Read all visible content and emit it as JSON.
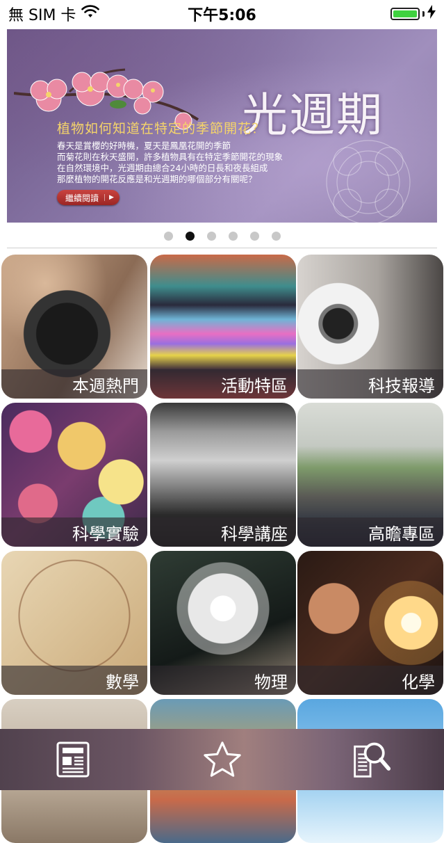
{
  "status_bar": {
    "carrier": "無 SIM 卡",
    "time": "下午5:06",
    "battery_level": 1.0,
    "icons": [
      "wifi-icon",
      "battery-icon",
      "charging-icon"
    ]
  },
  "banner": {
    "title": "光週期",
    "subtitle": "植物如何知道在特定的季節開花？",
    "body_lines": [
      "春天是賞櫻的好時機，夏天是鳳凰花開的季節",
      "而菊花則在秋天盛開，許多植物具有在特定季節開花的現象",
      "在自然環境中，光週期由總合24小時的日長和夜長組成",
      "那麼植物的開花反應是和光週期的哪個部分有關呢？"
    ],
    "read_more_label": "繼續閱讀",
    "read_more_icon": "play-arrow-icon"
  },
  "pager": {
    "count": 6,
    "active_index": 1
  },
  "tiles": [
    {
      "label": "本週熱門"
    },
    {
      "label": "活動特區"
    },
    {
      "label": "科技報導"
    },
    {
      "label": "科學實驗"
    },
    {
      "label": "科學講座"
    },
    {
      "label": "高瞻專區"
    },
    {
      "label": "數學"
    },
    {
      "label": "物理"
    },
    {
      "label": "化學"
    },
    {
      "label": ""
    },
    {
      "label": ""
    },
    {
      "label": ""
    }
  ],
  "tabbar": {
    "items": [
      {
        "icon": "newspaper-icon"
      },
      {
        "icon": "star-icon"
      },
      {
        "icon": "document-search-icon"
      }
    ]
  },
  "colors": {
    "battery": "#3fd23f",
    "banner_subtitle": "#f5d46a",
    "read_more_button": "#b5312e",
    "dot_active": "#111111",
    "dot_inactive": "#c8c8c8"
  }
}
